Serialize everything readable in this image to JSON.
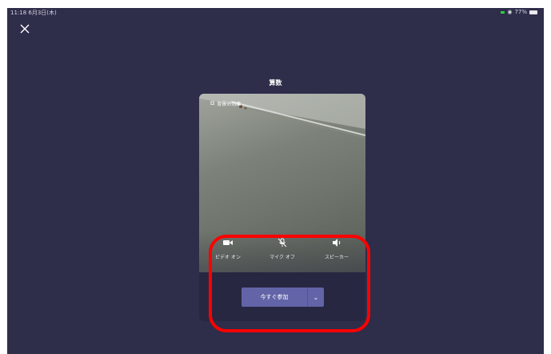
{
  "status_bar": {
    "time_date": "11:18 6月3日(木)",
    "center_text": "",
    "battery": "77%"
  },
  "meeting": {
    "title": "算数"
  },
  "preview": {
    "background_label": "背景の効果"
  },
  "controls": [
    {
      "name": "video",
      "label": "ビデオ オン"
    },
    {
      "name": "mic",
      "label": "マイク オフ"
    },
    {
      "name": "speaker",
      "label": "スピーカー"
    }
  ],
  "join": {
    "label": "今すぐ参加"
  },
  "colors": {
    "screen_bg": "#2e2d4a",
    "accent": "#6264a7",
    "annotation": "#ff0000"
  }
}
